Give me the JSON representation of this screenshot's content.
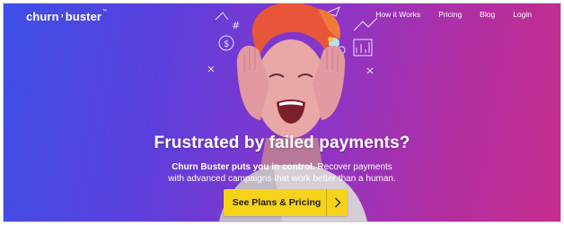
{
  "brand": {
    "name_left": "churn",
    "separator": "›",
    "name_right": "buster",
    "trademark": "™"
  },
  "nav": {
    "items": [
      {
        "label": "How it Works"
      },
      {
        "label": "Pricing"
      },
      {
        "label": "Blog"
      },
      {
        "label": "Login"
      }
    ]
  },
  "hero": {
    "headline": "Frustrated by failed payments?",
    "sub_bold": "Churn Buster puts you in control.",
    "sub_rest": " Recover payments",
    "sub_line2": "with advanced campaigns that work better than a human.",
    "cta_label": "See Plans & Pricing",
    "cta_icon": "chevron-right-icon"
  },
  "colors": {
    "gradient_start": "#3d4fe6",
    "gradient_end": "#c62d8c",
    "cta": "#f6d21a",
    "hair": "#e8563a"
  }
}
